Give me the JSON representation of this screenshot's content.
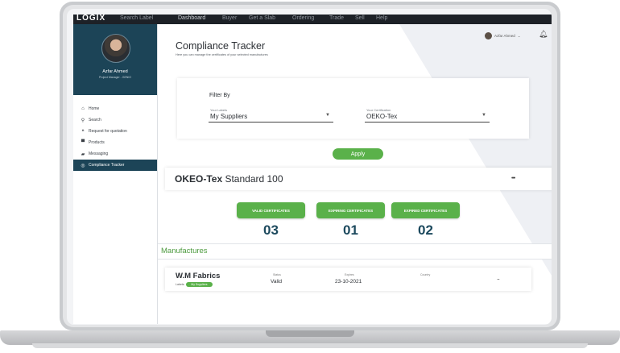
{
  "topbar": {
    "brand": "LOGIX",
    "items": [
      "Search Label",
      "Dashboard",
      "Buyer",
      "Get a Slab",
      "Ordering",
      "Trade",
      "Sell",
      "Help"
    ]
  },
  "sidebar": {
    "profile_name": "Azfar Ahmed",
    "profile_role": "Project Manager - GENIO",
    "items": [
      {
        "label": "Home",
        "icon": "home-icon"
      },
      {
        "label": "Search",
        "icon": "search-icon"
      },
      {
        "label": "Request for quotation",
        "icon": "quote-icon"
      },
      {
        "label": "Products",
        "icon": "cart-icon"
      },
      {
        "label": "Messaging",
        "icon": "chat-icon"
      },
      {
        "label": "Compliance Tracker",
        "icon": "target-icon",
        "active": true
      }
    ]
  },
  "header": {
    "title": "Compliance Tracker",
    "subtitle": "Here you can manage the certificates of your selected manufactures",
    "user_name": "Azfar Ahmed"
  },
  "filter": {
    "heading": "Filter By",
    "labels_field": {
      "label": "Your Labels",
      "value": "My Suppliers"
    },
    "cert_field": {
      "label": "Your Certification",
      "value": "OEKO-Tex"
    },
    "apply_label": "Apply"
  },
  "standard": {
    "title_bold": "OKEO-Tex",
    "title_rest": " Standard 100",
    "valid_label": "VALID CERTIFICATES",
    "valid_count": "03",
    "expiring_label": "EXPIRING CERTIFICATES",
    "expiring_count": "01",
    "expired_label": "EXPIRED CERTIFICATES",
    "expired_count": "02"
  },
  "manufactures": {
    "heading": "Manufactures",
    "rows": [
      {
        "name": "W.M Fabrics",
        "labels_caption": "Labels:",
        "badge": "My Suppliers",
        "status_head": "Status",
        "status": "Valid",
        "expiry_head": "Expires",
        "expiry": "23-10-2021",
        "country_head": "Country",
        "menu": "..."
      }
    ]
  },
  "colors": {
    "sidebar_dark": "#1c4457",
    "accent_green": "#5ab14a",
    "count_blue": "#1d4a5e"
  }
}
